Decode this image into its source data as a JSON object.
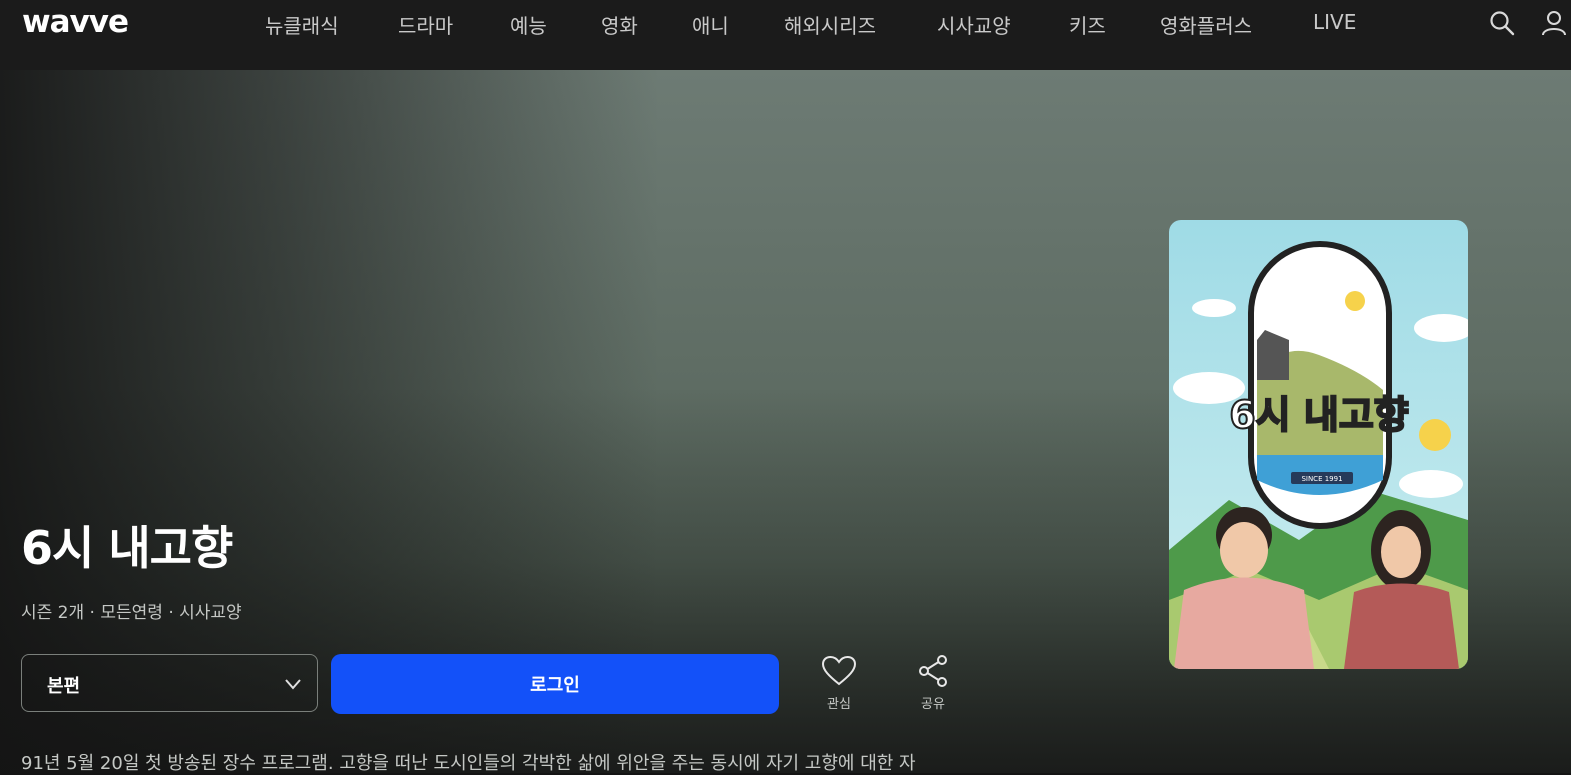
{
  "brand": {
    "logo": "wavve"
  },
  "nav": {
    "items": [
      {
        "label": "뉴클래식"
      },
      {
        "label": "드라마"
      },
      {
        "label": "예능"
      },
      {
        "label": "영화"
      },
      {
        "label": "애니"
      },
      {
        "label": "해외시리즈"
      },
      {
        "label": "시사교양"
      },
      {
        "label": "키즈"
      },
      {
        "label": "영화플러스"
      },
      {
        "label": "LIVE"
      }
    ],
    "icons": [
      "search-icon",
      "user-icon"
    ]
  },
  "program": {
    "title": "6시 내고향",
    "meta": "시즌 2개 · 모든연령 · 시사교양",
    "description": "91년 5월 20일 첫 방송된 장수 프로그램. 고향을 떠난 도시인들의 각박한 삶에 위안을 주는 동시에 자기 고향에 대한 자"
  },
  "poster": {
    "logo_text": "6시 내고향",
    "caption": "SINCE 1991"
  },
  "controls": {
    "episode_select": "본편",
    "login_button": "로그인",
    "like_label": "관심",
    "share_label": "공유"
  },
  "colors": {
    "accent": "#1351f9",
    "topbar": "#1b1b1b",
    "background": "#141414"
  }
}
